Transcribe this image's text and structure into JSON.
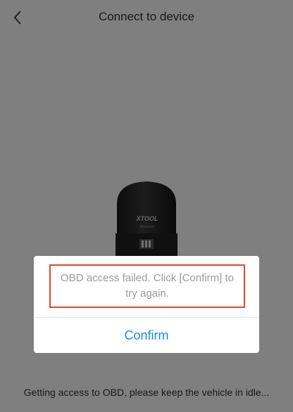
{
  "header": {
    "title": "Connect to device",
    "back_icon": "chevron-left-icon"
  },
  "device": {
    "brand": "XTOOL",
    "model": "Advancer"
  },
  "status": {
    "text": "Getting access to OBD, please keep the vehicle in idle..."
  },
  "dialog": {
    "message": "OBD access failed. Click [Confirm] to try again.",
    "confirm_label": "Confirm",
    "confirm_color": "#1a8ad8",
    "highlight_color": "#e2462c"
  }
}
